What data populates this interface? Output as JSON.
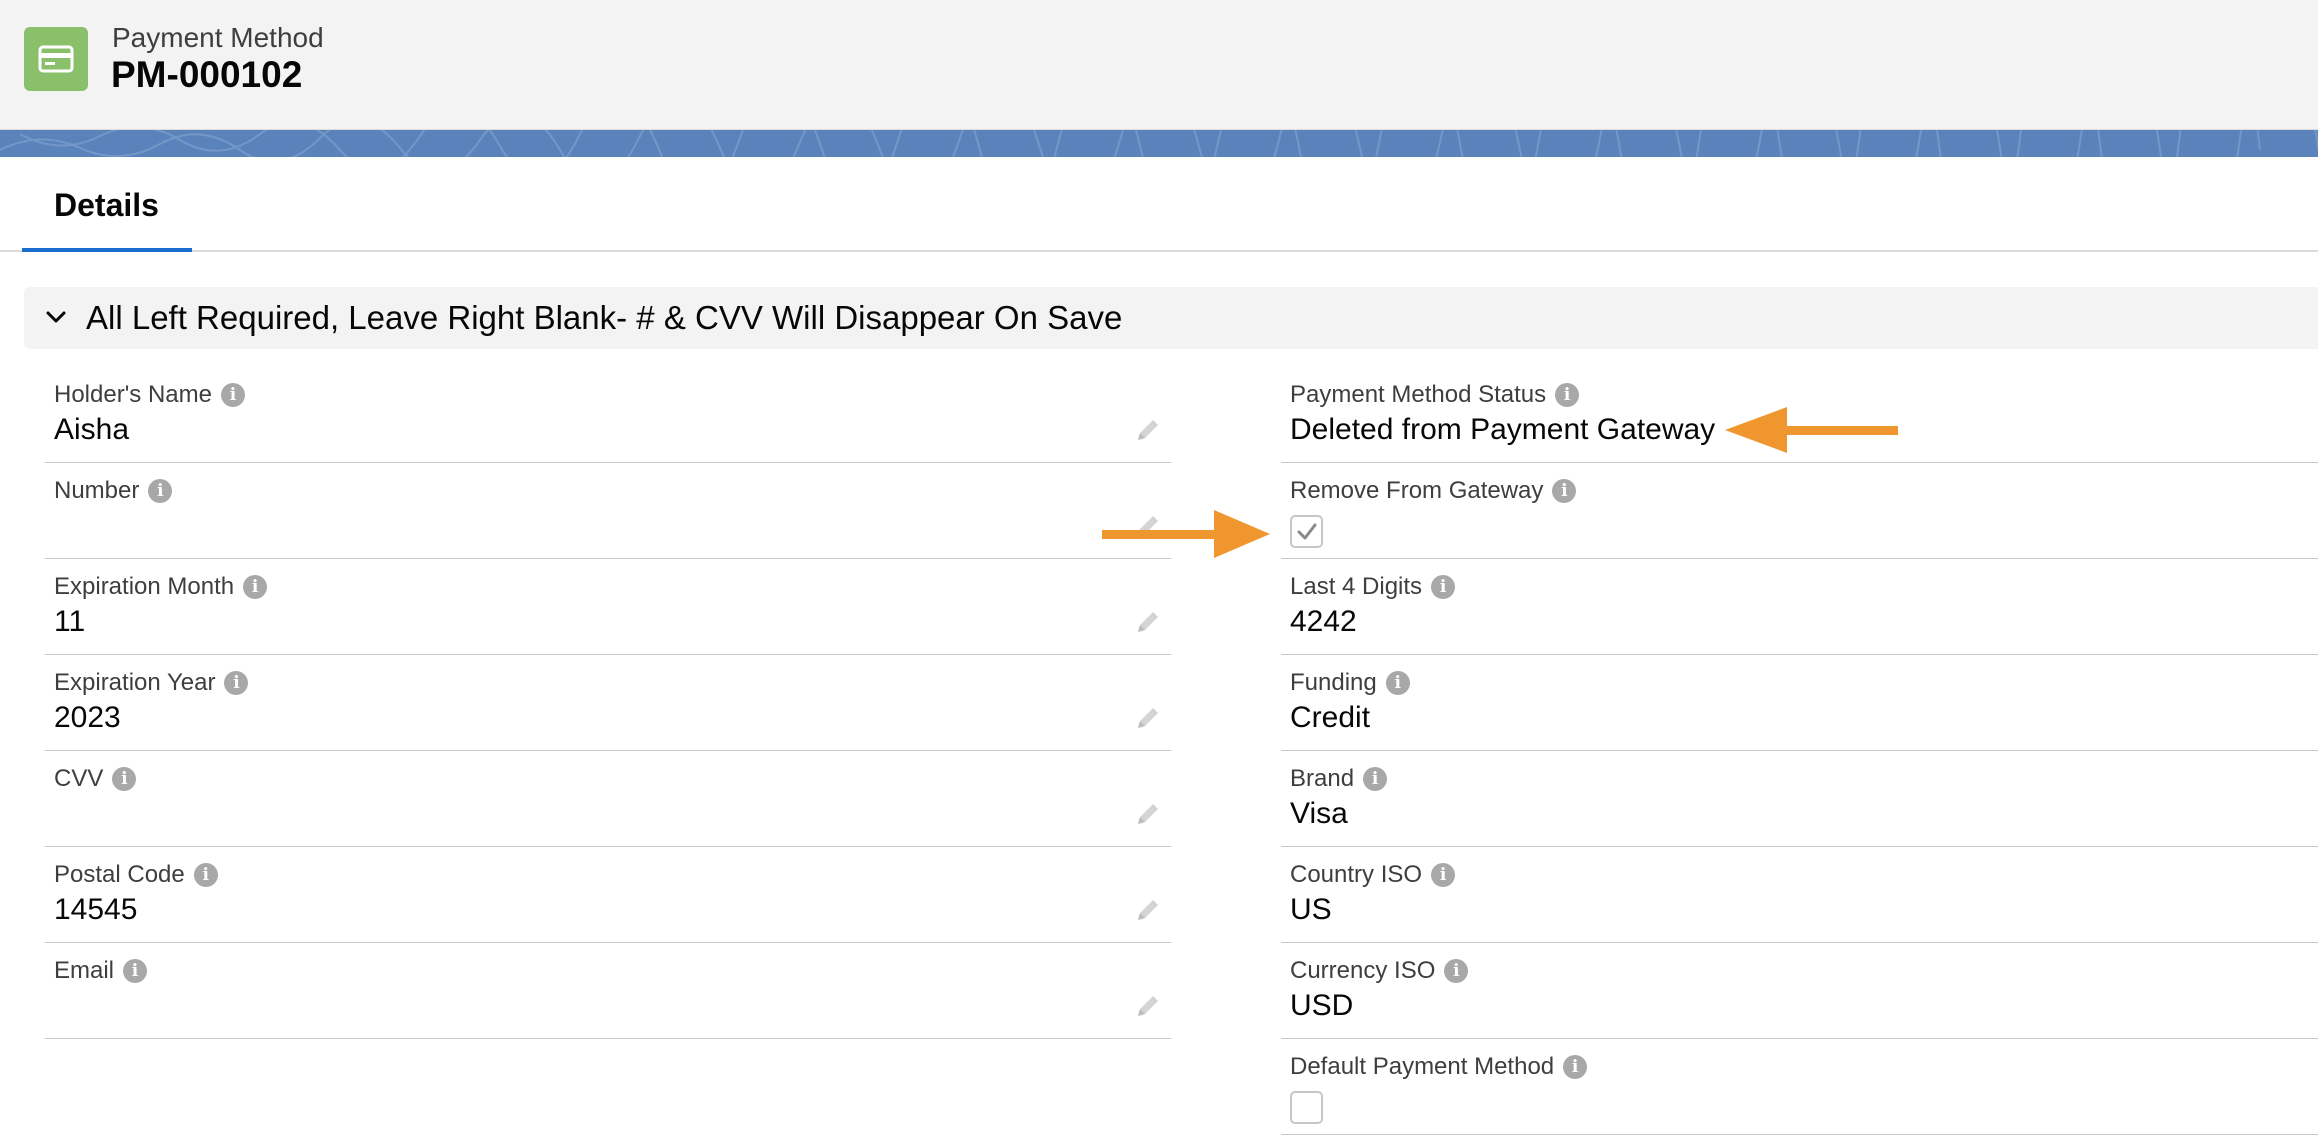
{
  "header": {
    "object_type": "Payment Method",
    "record_name": "PM-000102",
    "icon": "credit-card-icon",
    "icon_color": "#8bc06a"
  },
  "tabs": {
    "details_label": "Details"
  },
  "section": {
    "title": "All Left Required, Leave Right Blank- # & CVV Will Disappear On Save"
  },
  "left_fields": [
    {
      "label": "Holder's Name",
      "value": "Aisha"
    },
    {
      "label": "Number",
      "value": ""
    },
    {
      "label": "Expiration Month",
      "value": "11"
    },
    {
      "label": "Expiration Year",
      "value": "2023"
    },
    {
      "label": "CVV",
      "value": ""
    },
    {
      "label": "Postal Code",
      "value": "14545"
    },
    {
      "label": "Email",
      "value": ""
    }
  ],
  "right_fields": [
    {
      "label": "Payment Method Status",
      "value": "Deleted from Payment Gateway"
    },
    {
      "label": "Remove From Gateway",
      "checked": true
    },
    {
      "label": "Last 4 Digits",
      "value": "4242"
    },
    {
      "label": "Funding",
      "value": "Credit"
    },
    {
      "label": "Brand",
      "value": "Visa"
    },
    {
      "label": "Country ISO",
      "value": "US"
    },
    {
      "label": "Currency ISO",
      "value": "USD"
    },
    {
      "label": "Default Payment Method",
      "checked": false
    }
  ],
  "colors": {
    "accent": "#1b6ccf",
    "annotation_arrow": "#f0962e",
    "banner": "#5b83bb"
  }
}
